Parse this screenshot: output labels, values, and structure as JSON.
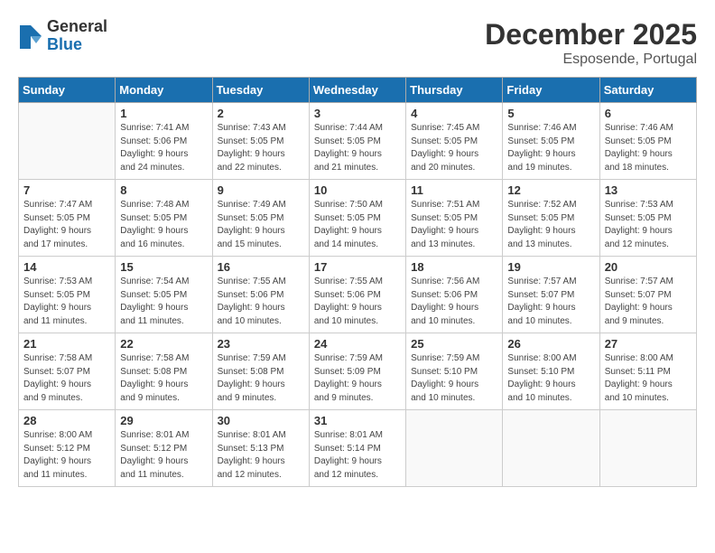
{
  "header": {
    "logo": {
      "general": "General",
      "blue": "Blue"
    },
    "title": "December 2025",
    "location": "Esposende, Portugal"
  },
  "weekdays": [
    "Sunday",
    "Monday",
    "Tuesday",
    "Wednesday",
    "Thursday",
    "Friday",
    "Saturday"
  ],
  "weeks": [
    [
      {
        "day": null,
        "info": null
      },
      {
        "day": "1",
        "info": "Sunrise: 7:41 AM\nSunset: 5:06 PM\nDaylight: 9 hours\nand 24 minutes."
      },
      {
        "day": "2",
        "info": "Sunrise: 7:43 AM\nSunset: 5:05 PM\nDaylight: 9 hours\nand 22 minutes."
      },
      {
        "day": "3",
        "info": "Sunrise: 7:44 AM\nSunset: 5:05 PM\nDaylight: 9 hours\nand 21 minutes."
      },
      {
        "day": "4",
        "info": "Sunrise: 7:45 AM\nSunset: 5:05 PM\nDaylight: 9 hours\nand 20 minutes."
      },
      {
        "day": "5",
        "info": "Sunrise: 7:46 AM\nSunset: 5:05 PM\nDaylight: 9 hours\nand 19 minutes."
      },
      {
        "day": "6",
        "info": "Sunrise: 7:46 AM\nSunset: 5:05 PM\nDaylight: 9 hours\nand 18 minutes."
      }
    ],
    [
      {
        "day": "7",
        "info": "Sunrise: 7:47 AM\nSunset: 5:05 PM\nDaylight: 9 hours\nand 17 minutes."
      },
      {
        "day": "8",
        "info": "Sunrise: 7:48 AM\nSunset: 5:05 PM\nDaylight: 9 hours\nand 16 minutes."
      },
      {
        "day": "9",
        "info": "Sunrise: 7:49 AM\nSunset: 5:05 PM\nDaylight: 9 hours\nand 15 minutes."
      },
      {
        "day": "10",
        "info": "Sunrise: 7:50 AM\nSunset: 5:05 PM\nDaylight: 9 hours\nand 14 minutes."
      },
      {
        "day": "11",
        "info": "Sunrise: 7:51 AM\nSunset: 5:05 PM\nDaylight: 9 hours\nand 13 minutes."
      },
      {
        "day": "12",
        "info": "Sunrise: 7:52 AM\nSunset: 5:05 PM\nDaylight: 9 hours\nand 13 minutes."
      },
      {
        "day": "13",
        "info": "Sunrise: 7:53 AM\nSunset: 5:05 PM\nDaylight: 9 hours\nand 12 minutes."
      }
    ],
    [
      {
        "day": "14",
        "info": "Sunrise: 7:53 AM\nSunset: 5:05 PM\nDaylight: 9 hours\nand 11 minutes."
      },
      {
        "day": "15",
        "info": "Sunrise: 7:54 AM\nSunset: 5:05 PM\nDaylight: 9 hours\nand 11 minutes."
      },
      {
        "day": "16",
        "info": "Sunrise: 7:55 AM\nSunset: 5:06 PM\nDaylight: 9 hours\nand 10 minutes."
      },
      {
        "day": "17",
        "info": "Sunrise: 7:55 AM\nSunset: 5:06 PM\nDaylight: 9 hours\nand 10 minutes."
      },
      {
        "day": "18",
        "info": "Sunrise: 7:56 AM\nSunset: 5:06 PM\nDaylight: 9 hours\nand 10 minutes."
      },
      {
        "day": "19",
        "info": "Sunrise: 7:57 AM\nSunset: 5:07 PM\nDaylight: 9 hours\nand 10 minutes."
      },
      {
        "day": "20",
        "info": "Sunrise: 7:57 AM\nSunset: 5:07 PM\nDaylight: 9 hours\nand 9 minutes."
      }
    ],
    [
      {
        "day": "21",
        "info": "Sunrise: 7:58 AM\nSunset: 5:07 PM\nDaylight: 9 hours\nand 9 minutes."
      },
      {
        "day": "22",
        "info": "Sunrise: 7:58 AM\nSunset: 5:08 PM\nDaylight: 9 hours\nand 9 minutes."
      },
      {
        "day": "23",
        "info": "Sunrise: 7:59 AM\nSunset: 5:08 PM\nDaylight: 9 hours\nand 9 minutes."
      },
      {
        "day": "24",
        "info": "Sunrise: 7:59 AM\nSunset: 5:09 PM\nDaylight: 9 hours\nand 9 minutes."
      },
      {
        "day": "25",
        "info": "Sunrise: 7:59 AM\nSunset: 5:10 PM\nDaylight: 9 hours\nand 10 minutes."
      },
      {
        "day": "26",
        "info": "Sunrise: 8:00 AM\nSunset: 5:10 PM\nDaylight: 9 hours\nand 10 minutes."
      },
      {
        "day": "27",
        "info": "Sunrise: 8:00 AM\nSunset: 5:11 PM\nDaylight: 9 hours\nand 10 minutes."
      }
    ],
    [
      {
        "day": "28",
        "info": "Sunrise: 8:00 AM\nSunset: 5:12 PM\nDaylight: 9 hours\nand 11 minutes."
      },
      {
        "day": "29",
        "info": "Sunrise: 8:01 AM\nSunset: 5:12 PM\nDaylight: 9 hours\nand 11 minutes."
      },
      {
        "day": "30",
        "info": "Sunrise: 8:01 AM\nSunset: 5:13 PM\nDaylight: 9 hours\nand 12 minutes."
      },
      {
        "day": "31",
        "info": "Sunrise: 8:01 AM\nSunset: 5:14 PM\nDaylight: 9 hours\nand 12 minutes."
      },
      {
        "day": null,
        "info": null
      },
      {
        "day": null,
        "info": null
      },
      {
        "day": null,
        "info": null
      }
    ]
  ]
}
